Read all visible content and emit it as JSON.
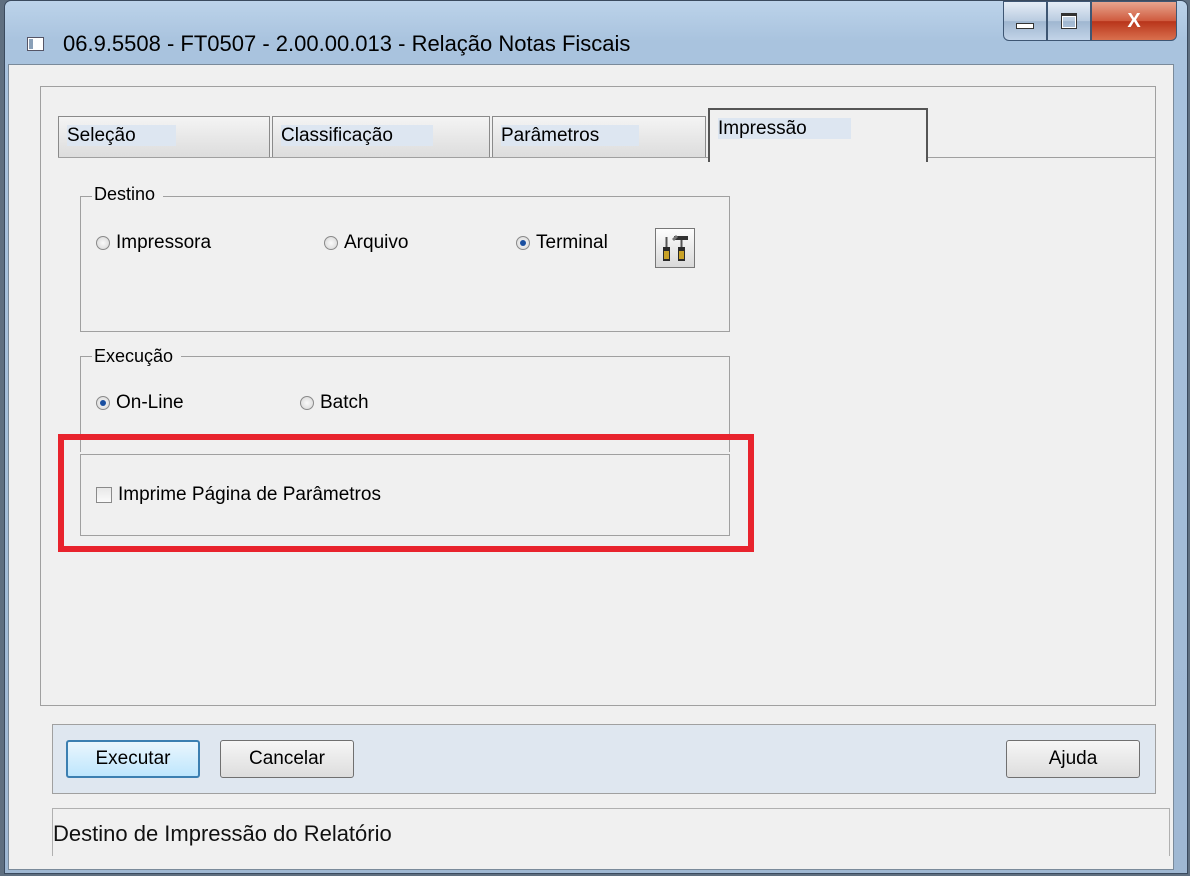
{
  "window": {
    "title": "06.9.5508 - FT0507 - 2.00.00.013 - Relação Notas Fiscais",
    "close_glyph": "X"
  },
  "tabs": [
    {
      "label": "Seleção",
      "active": false
    },
    {
      "label": "Classificação",
      "active": false
    },
    {
      "label": "Parâmetros",
      "active": false
    },
    {
      "label": "Impressão",
      "active": true
    }
  ],
  "destino": {
    "title": "Destino",
    "options": [
      {
        "label": "Impressora",
        "selected": false
      },
      {
        "label": "Arquivo",
        "selected": false
      },
      {
        "label": "Terminal",
        "selected": true
      }
    ],
    "tool_icon": "tools-icon"
  },
  "execucao": {
    "title": "Execução",
    "options": [
      {
        "label": "On-Line",
        "selected": true
      },
      {
        "label": "Batch",
        "selected": false
      }
    ]
  },
  "params": {
    "checkbox_label": "Imprime Página de Parâmetros",
    "checked": false
  },
  "buttons": {
    "executar": "Executar",
    "cancelar": "Cancelar",
    "ajuda": "Ajuda"
  },
  "status": {
    "text": "Destino de Impressão do Relatório"
  },
  "colors": {
    "highlight": "#e8232d",
    "radio_selected": "#1a4fa0"
  }
}
